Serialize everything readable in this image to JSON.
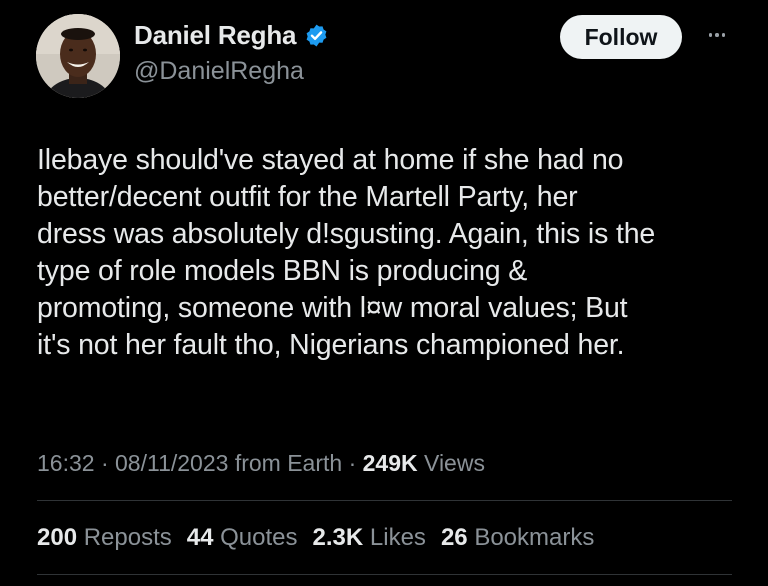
{
  "author": {
    "display_name": "Daniel Regha",
    "handle": "@DanielRegha",
    "verified": true,
    "verified_color": "#1d9bf0"
  },
  "follow_label": "Follow",
  "tweet_text": "Ilebaye should've stayed at home if she had no\nbetter/decent outfit for the Martell Party, her\ndress was absolutely d!sgusting. Again, this is the\ntype of role models BBN is producing &\npromoting, someone with l¤w moral values; But\nit's not her fault tho, Nigerians championed her.",
  "meta": {
    "time": "16:32",
    "separator": " · ",
    "date": "08/11/2023",
    "source": "from Earth",
    "views_count": "249K",
    "views_label": "Views"
  },
  "stats": [
    {
      "count": "200",
      "label": "Reposts"
    },
    {
      "count": "44",
      "label": "Quotes"
    },
    {
      "count": "2.3K",
      "label": "Likes"
    },
    {
      "count": "26",
      "label": "Bookmarks"
    }
  ],
  "icons": {
    "verified": "verified-badge-icon",
    "more": "more-options-icon"
  }
}
